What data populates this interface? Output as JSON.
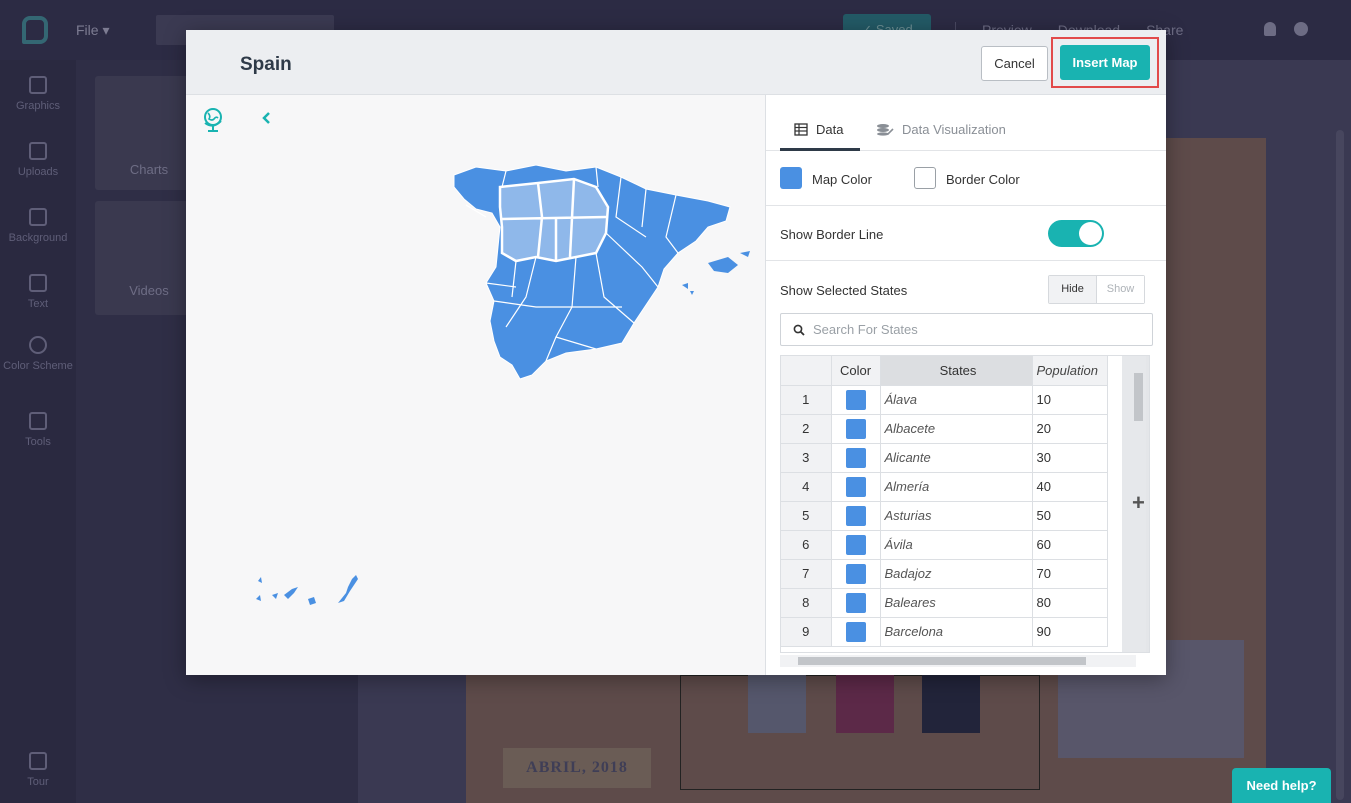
{
  "app": {
    "file_menu": "File ▾",
    "saved_label": "✓ Saved",
    "top_actions": [
      "Preview",
      "Download",
      "Share"
    ],
    "nav_items": [
      "Graphics",
      "Uploads",
      "Background",
      "Text",
      "Color Scheme",
      "Tools",
      "Tour"
    ],
    "panel_cards": [
      "Charts",
      "Videos"
    ],
    "canvas_label": "ABRIL, 2018",
    "need_help": "Need help?"
  },
  "modal": {
    "title": "Spain",
    "cancel_label": "Cancel",
    "insert_label": "Insert Map",
    "tabs": [
      {
        "label": "Data",
        "active": true
      },
      {
        "label": "Data Visualization",
        "active": false
      }
    ],
    "map_color_label": "Map Color",
    "border_color_label": "Border Color",
    "map_color": "#4a90e2",
    "border_color": "#ffffff",
    "show_border_label": "Show Border Line",
    "show_border_on": true,
    "selected_states_label": "Show Selected States",
    "hide_label": "Hide",
    "show_label": "Show",
    "search_placeholder": "Search For States",
    "table": {
      "headers": {
        "color": "Color",
        "states": "States",
        "population": "Population"
      },
      "rows": [
        {
          "n": "1",
          "state": "Álava",
          "pop": "10"
        },
        {
          "n": "2",
          "state": "Albacete",
          "pop": "20"
        },
        {
          "n": "3",
          "state": "Alicante",
          "pop": "30"
        },
        {
          "n": "4",
          "state": "Almería",
          "pop": "40"
        },
        {
          "n": "5",
          "state": "Asturias",
          "pop": "50"
        },
        {
          "n": "6",
          "state": "Ávila",
          "pop": "60"
        },
        {
          "n": "7",
          "state": "Badajoz",
          "pop": "70"
        },
        {
          "n": "8",
          "state": "Baleares",
          "pop": "80"
        },
        {
          "n": "9",
          "state": "Barcelona",
          "pop": "90"
        }
      ]
    },
    "icons": [
      "globe-icon",
      "chevron-left-icon",
      "table-icon",
      "layers-edit-icon",
      "search-icon",
      "plus-icon"
    ]
  }
}
